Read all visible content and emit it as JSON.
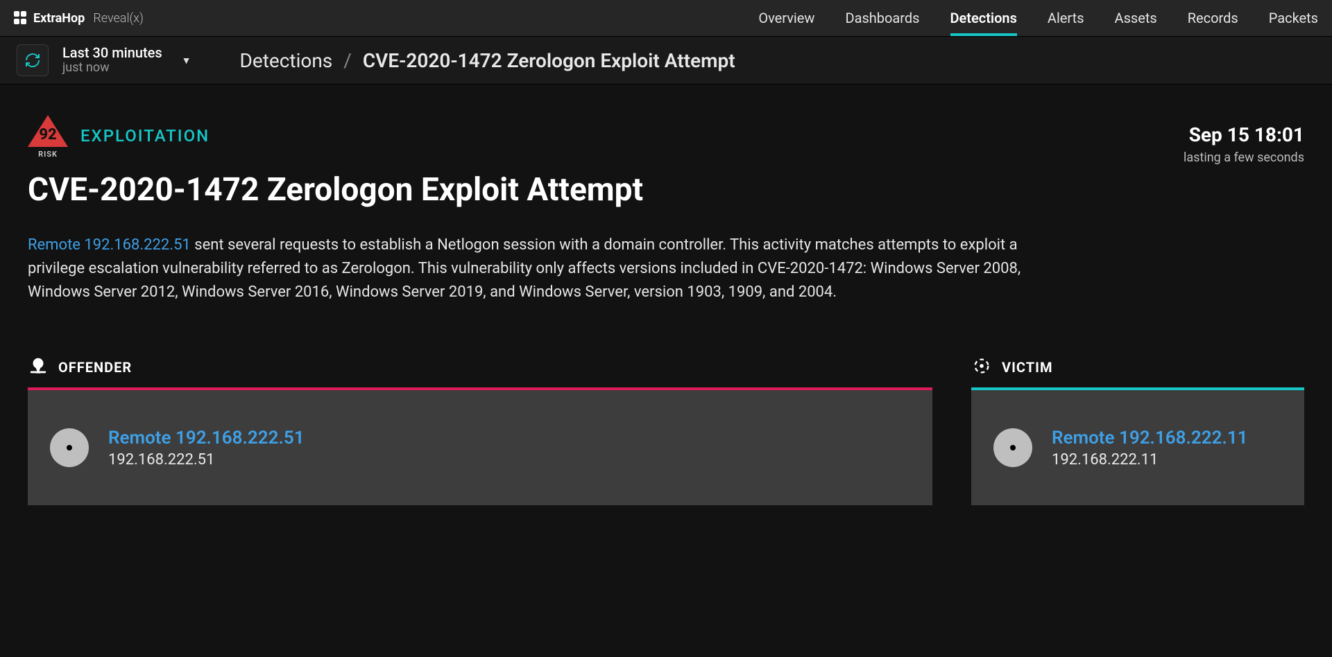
{
  "brand": {
    "name": "ExtraHop",
    "product": "Reveal(x)"
  },
  "nav": {
    "items": [
      "Overview",
      "Dashboards",
      "Detections",
      "Alerts",
      "Assets",
      "Records",
      "Packets"
    ],
    "active": "Detections"
  },
  "timeRange": {
    "primary": "Last 30 minutes",
    "secondary": "just now"
  },
  "breadcrumb": {
    "root": "Detections",
    "current": "CVE-2020-1472 Zerologon Exploit Attempt"
  },
  "detection": {
    "riskScore": "92",
    "riskLabel": "RISK",
    "category": "EXPLOITATION",
    "title": "CVE-2020-1472 Zerologon Exploit Attempt",
    "timestamp": "Sep 15 18:01",
    "duration": "lasting a few seconds",
    "description_link": "Remote 192.168.222.51",
    "description_rest": " sent several requests to establish a Netlogon session with a domain controller. This activity matches attempts to exploit a privilege escalation vulnerability referred to as Zerologon. This vulnerability only affects versions included in CVE-2020-1472: Windows Server 2008, Windows Server 2012, Windows Server 2016, Windows Server 2019, and Windows Server, version 1903, 1909, and 2004."
  },
  "parties": {
    "offender": {
      "label": "OFFENDER",
      "name": "Remote 192.168.222.51",
      "ip": "192.168.222.51"
    },
    "victim": {
      "label": "VICTIM",
      "name": "Remote 192.168.222.11",
      "ip": "192.168.222.11"
    }
  }
}
